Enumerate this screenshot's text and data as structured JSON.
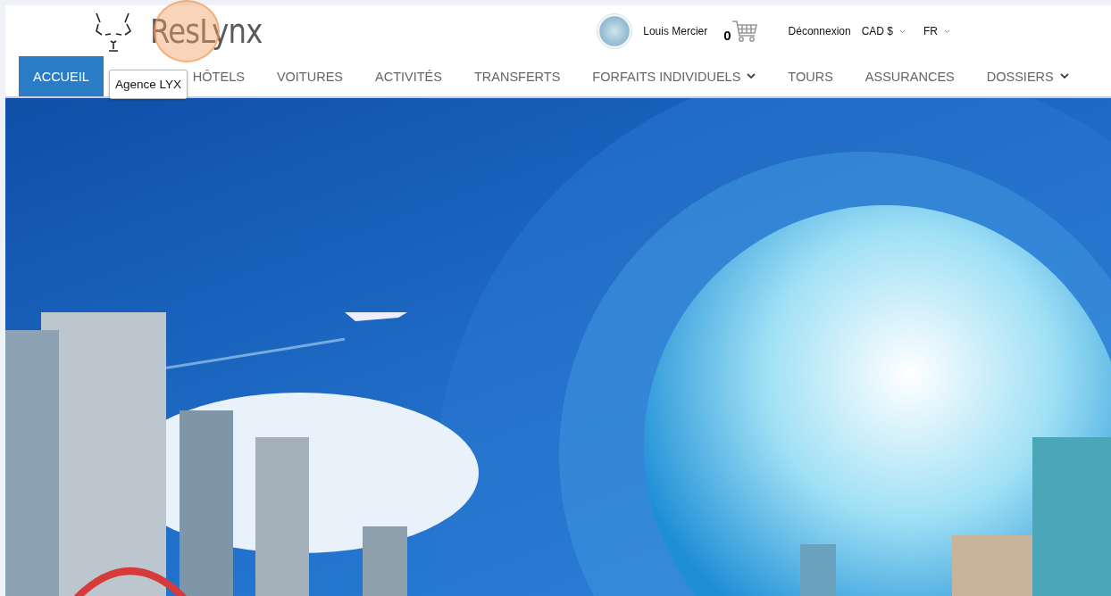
{
  "header": {
    "logo_text": "ResLynx",
    "user_name": "Louis Mercier",
    "cart_count": "0",
    "logout": "Déconnexion",
    "currency": "CAD $",
    "language": "FR"
  },
  "nav": [
    {
      "label": "ACCUEIL",
      "selected": true,
      "dropdown": false
    },
    {
      "label": "HÔTELS",
      "selected": false,
      "dropdown": false
    },
    {
      "label": "VOITURES",
      "selected": false,
      "dropdown": false
    },
    {
      "label": "ACTIVITÉS",
      "selected": false,
      "dropdown": false
    },
    {
      "label": "TRANSFERTS",
      "selected": false,
      "dropdown": false
    },
    {
      "label": "FORFAITS INDIVIDUELS",
      "selected": false,
      "dropdown": true
    },
    {
      "label": "TOURS",
      "selected": false,
      "dropdown": false
    },
    {
      "label": "ASSURANCES",
      "selected": false,
      "dropdown": false
    },
    {
      "label": "DOSSIERS",
      "selected": false,
      "dropdown": true
    }
  ],
  "tooltip": "Agence LYX"
}
